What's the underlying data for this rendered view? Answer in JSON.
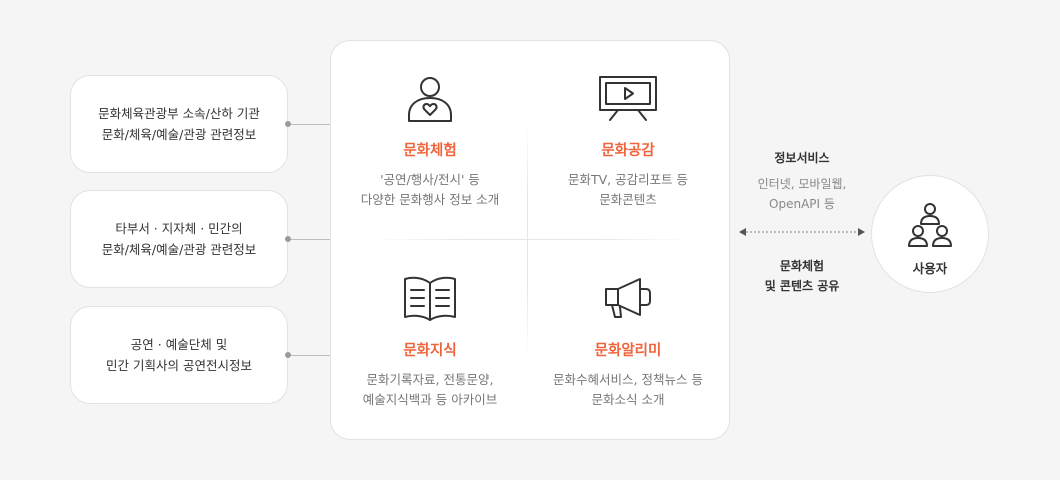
{
  "sources": [
    {
      "lines": [
        "문화체육관광부 소속/산하 기관",
        "문화/체육/예술/관광 관련정보"
      ]
    },
    {
      "lines": [
        "타부서 · 지자체 · 민간의",
        "문화/체육/예술/관광 관련정보"
      ]
    },
    {
      "lines": [
        "공연 · 예술단체 및",
        "민간 기획사의 공연전시정보"
      ]
    }
  ],
  "services": [
    {
      "title": "문화체험",
      "desc": [
        "'공연/행사/전시' 등",
        "다양한 문화행사 정보 소개"
      ],
      "icon": "person-heart-icon"
    },
    {
      "title": "문화공감",
      "desc": [
        "문화TV, 공감리포트 등",
        "문화콘텐츠"
      ],
      "icon": "tv-play-icon"
    },
    {
      "title": "문화지식",
      "desc": [
        "문화기록자료, 전통문양,",
        "예술지식백과 등 아카이브"
      ],
      "icon": "open-book-icon"
    },
    {
      "title": "문화알리미",
      "desc": [
        "문화수혜서비스, 정책뉴스 등",
        "문화소식 소개"
      ],
      "icon": "megaphone-icon"
    }
  ],
  "flow": {
    "top_title": "정보서비스",
    "top_desc": [
      "인터넷, 모바일웹,",
      "OpenAPI 등"
    ],
    "bottom_title": [
      "문화체험",
      "및 콘텐츠 공유"
    ]
  },
  "user": {
    "label": "사용자",
    "icon": "users-group-icon"
  },
  "colors": {
    "accent": "#f0643c",
    "line": "#bdbdbd",
    "background": "#f5f5f5"
  }
}
